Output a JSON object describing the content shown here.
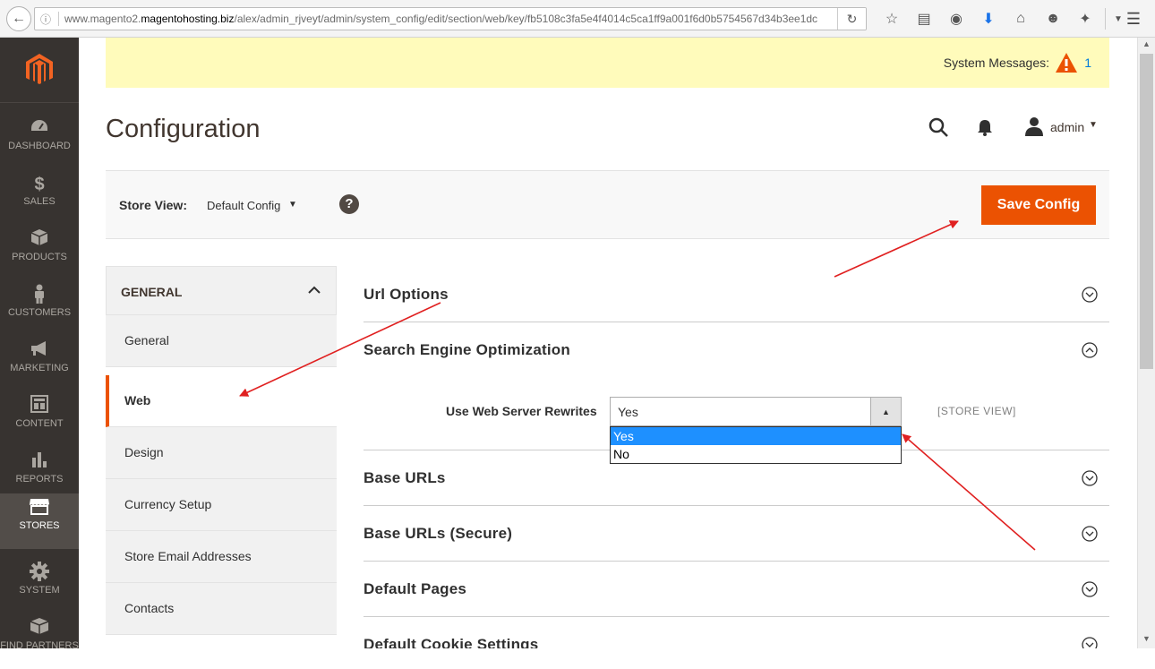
{
  "browser": {
    "url_prefix": "www.magento2.",
    "url_domain": "magentohosting.biz",
    "url_path": "/alex/admin_rjveyt/admin/system_config/edit/section/web/key/fb5108c3fa5e4f4014c5ca1ff9a001f6d0b5754567d34b3ee1dc"
  },
  "admin_nav": {
    "items": [
      {
        "label": "Dashboard",
        "icon": "gauge-icon"
      },
      {
        "label": "Sales",
        "icon": "dollar-icon"
      },
      {
        "label": "Products",
        "icon": "cube-icon"
      },
      {
        "label": "Customers",
        "icon": "person-icon"
      },
      {
        "label": "Marketing",
        "icon": "megaphone-icon"
      },
      {
        "label": "Content",
        "icon": "layout-icon"
      },
      {
        "label": "Reports",
        "icon": "bar-chart-icon"
      },
      {
        "label": "Stores",
        "icon": "store-icon",
        "active": true
      },
      {
        "label": "System",
        "icon": "gear-icon"
      },
      {
        "label": "Find Partners",
        "icon": "blocks-icon"
      }
    ]
  },
  "system_messages": {
    "label": "System Messages:",
    "count": "1"
  },
  "header": {
    "title": "Configuration",
    "user": "admin"
  },
  "store_switcher": {
    "label": "Store View:",
    "value": "Default Config"
  },
  "actions": {
    "save_label": "Save Config"
  },
  "tabs": {
    "group": "General",
    "items": [
      {
        "label": "General"
      },
      {
        "label": "Web",
        "active": true
      },
      {
        "label": "Design"
      },
      {
        "label": "Currency Setup"
      },
      {
        "label": "Store Email Addresses"
      },
      {
        "label": "Contacts"
      }
    ]
  },
  "sections": [
    {
      "title": "Url Options",
      "expanded": false
    },
    {
      "title": "Search Engine Optimization",
      "expanded": true
    },
    {
      "title": "Base URLs",
      "expanded": false
    },
    {
      "title": "Base URLs (Secure)",
      "expanded": false
    },
    {
      "title": "Default Pages",
      "expanded": false
    },
    {
      "title": "Default Cookie Settings",
      "expanded": false
    }
  ],
  "seo_field": {
    "label": "Use Web Server Rewrites",
    "value": "Yes",
    "options": [
      "Yes",
      "No"
    ],
    "selected_option": "Yes",
    "scope": "[STORE VIEW]"
  },
  "colors": {
    "accent": "#eb5202",
    "nav_bg": "#373330",
    "message_bg": "#fffbbb",
    "annotation_arrow": "#e02020"
  }
}
